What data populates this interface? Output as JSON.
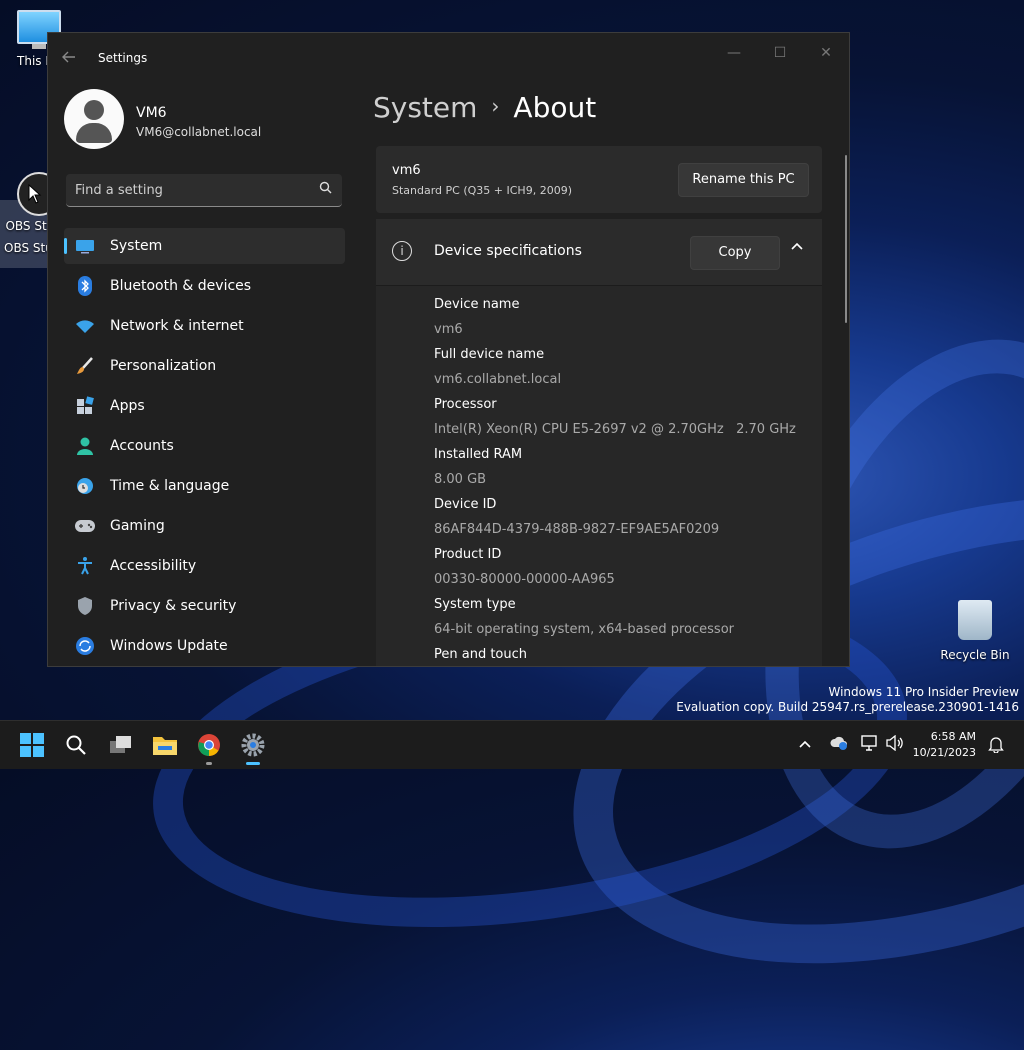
{
  "desktop": {
    "icons": [
      {
        "label": "This PC"
      },
      {
        "label": "OBS Studio"
      },
      {
        "label": "OBS Studio"
      },
      {
        "label": "Recycle Bin"
      }
    ],
    "watermark": {
      "line1": "Windows 11 Pro Insider Preview",
      "line2": "Evaluation copy. Build 25947.rs_prerelease.230901-1416"
    }
  },
  "window": {
    "title": "Settings",
    "controls": {
      "minimize": "—",
      "maximize": "☐",
      "close": "✕"
    },
    "profile": {
      "name": "VM6",
      "email": "VM6@collabnet.local"
    },
    "search": {
      "placeholder": "Find a setting"
    },
    "nav": [
      {
        "label": "System",
        "icon": "monitor-icon",
        "active": true
      },
      {
        "label": "Bluetooth & devices",
        "icon": "bluetooth-icon"
      },
      {
        "label": "Network & internet",
        "icon": "wifi-icon"
      },
      {
        "label": "Personalization",
        "icon": "brush-icon"
      },
      {
        "label": "Apps",
        "icon": "apps-icon"
      },
      {
        "label": "Accounts",
        "icon": "person-icon"
      },
      {
        "label": "Time & language",
        "icon": "globe-clock-icon"
      },
      {
        "label": "Gaming",
        "icon": "gamepad-icon"
      },
      {
        "label": "Accessibility",
        "icon": "accessibility-icon"
      },
      {
        "label": "Privacy & security",
        "icon": "shield-icon"
      },
      {
        "label": "Windows Update",
        "icon": "update-icon"
      }
    ],
    "breadcrumb": {
      "parent": "System",
      "separator": "›",
      "current": "About"
    },
    "pc": {
      "name": "vm6",
      "model": "Standard PC (Q35 + ICH9, 2009)",
      "rename_label": "Rename this PC"
    },
    "specs": {
      "title": "Device specifications",
      "copy_label": "Copy",
      "rows": [
        {
          "label": "Device name",
          "value": "vm6"
        },
        {
          "label": "Full device name",
          "value": "vm6.collabnet.local"
        },
        {
          "label": "Processor",
          "value": "Intel(R) Xeon(R) CPU E5-2697 v2 @ 2.70GHz   2.70 GHz"
        },
        {
          "label": "Installed RAM",
          "value": "8.00 GB"
        },
        {
          "label": "Device ID",
          "value": "86AF844D-4379-488B-9827-EF9AE5AF0209"
        },
        {
          "label": "Product ID",
          "value": "00330-80000-00000-AA965"
        },
        {
          "label": "System type",
          "value": "64-bit operating system, x64-based processor"
        },
        {
          "label": "Pen and touch",
          "value": ""
        }
      ]
    }
  },
  "taskbar": {
    "clock_time": "6:58 AM",
    "clock_date": "10/21/2023"
  },
  "colors": {
    "accent": "#4cc2ff",
    "window_bg": "#202020",
    "card_bg": "#2b2b2b"
  }
}
